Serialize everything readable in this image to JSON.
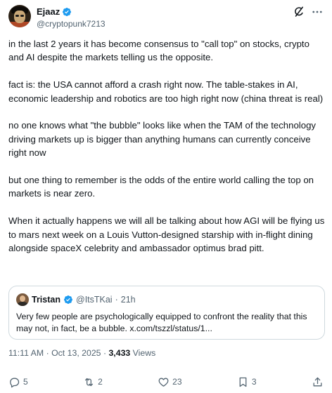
{
  "author": {
    "display_name": "Ejaaz",
    "handle": "@cryptopunk7213"
  },
  "icons": {
    "verified": "verified-badge-icon",
    "grok": "grok-icon",
    "more": "more-icon",
    "reply": "reply-icon",
    "retweet": "retweet-icon",
    "like": "like-icon",
    "bookmark": "bookmark-icon",
    "share": "share-icon"
  },
  "colors": {
    "accent": "#1d9bf0",
    "muted": "#536471",
    "text": "#0f1419"
  },
  "tweet": {
    "paragraphs": [
      "in the last 2 years it has become consensus to \"call top\" on stocks, crypto and AI despite the markets telling us the opposite.",
      "fact is: the USA cannot afford a crash right now. The table-stakes in AI, economic leadership and robotics are too high right now (china threat is real)",
      "no one knows what \"the bubble\" looks like when the TAM of the technology driving markets up is bigger than anything humans can currently conceive right now",
      "but one thing to remember is the odds of the entire world calling the top on markets is near zero.",
      "When it actually happens we will all be talking about how AGI will be flying us to mars next week on a Louis Vutton-designed starship with in-flight dining alongside spaceX celebrity and ambassador optimus brad pitt."
    ]
  },
  "quote": {
    "display_name": "Tristan",
    "handle": "@ItsTKai",
    "separator": "·",
    "time": "21h",
    "text": "Very few people are psychologically equipped to confront the reality that this may not, in fact, be a bubble. x.com/tszzl/status/1..."
  },
  "meta": {
    "time": "11:11 AM",
    "separator": "·",
    "date": "Oct 13, 2025",
    "separator2": "·",
    "views_count": "3,433",
    "views_label": "Views"
  },
  "stats": {
    "replies": "5",
    "reposts": "2",
    "likes": "23",
    "bookmarks": "3"
  }
}
